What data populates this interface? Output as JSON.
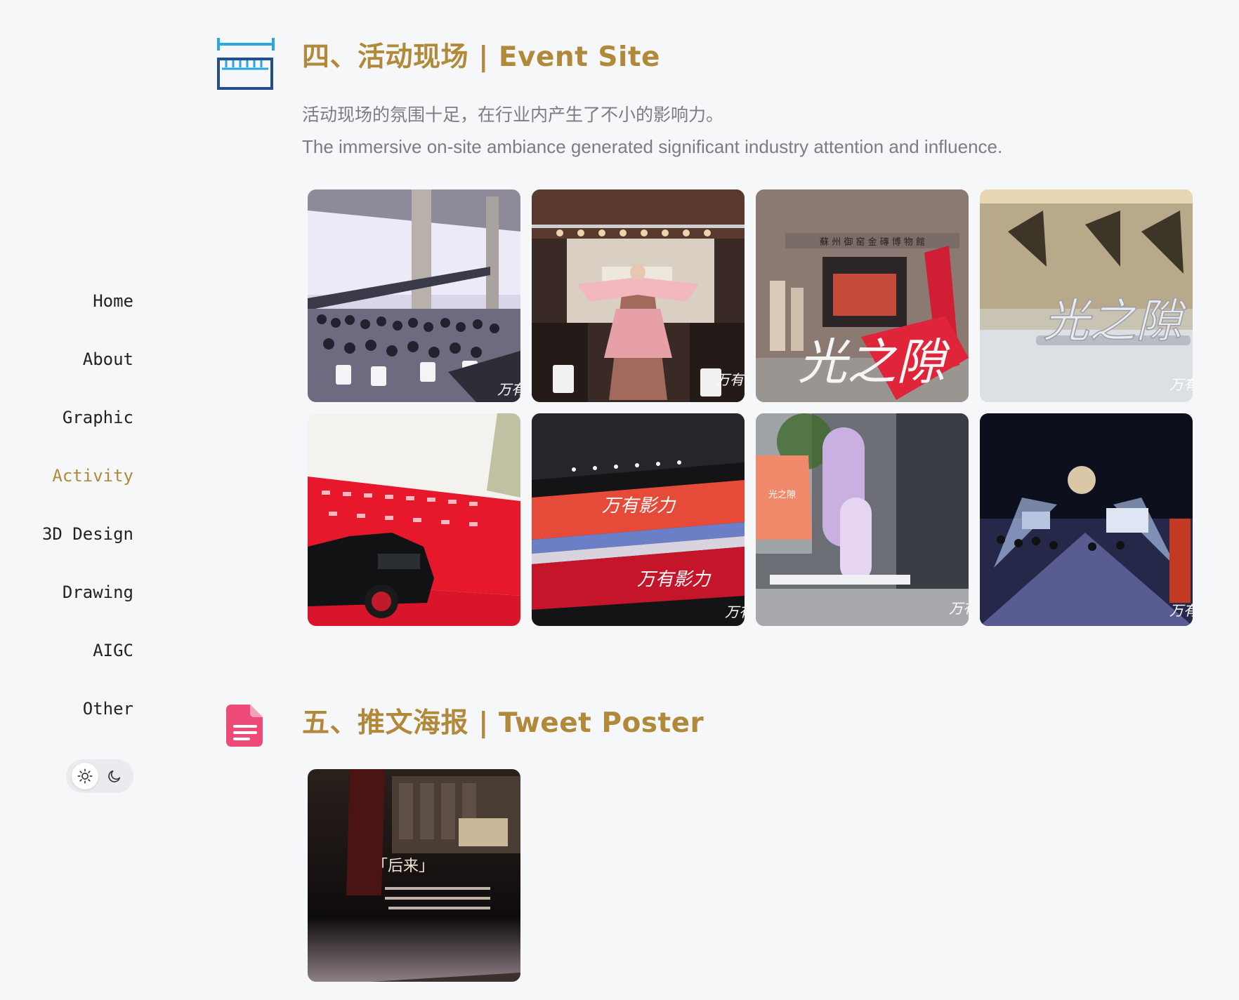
{
  "sidebar": {
    "nav": [
      {
        "label": "Home"
      },
      {
        "label": "About"
      },
      {
        "label": "Graphic"
      },
      {
        "label": "Activity"
      },
      {
        "label": "3D Design"
      },
      {
        "label": "Drawing"
      },
      {
        "label": "AIGC"
      },
      {
        "label": "Other"
      }
    ],
    "active_item": "Activity",
    "theme_toggle": {
      "options": [
        "sun-icon",
        "moon-icon"
      ],
      "selected": "light"
    }
  },
  "sections": {
    "event_site": {
      "title": "四、活动现场 | Event Site",
      "icon": "ruler-icon",
      "desc_cn": "活动现场的氛围十足，在行业内产生了不小的影响力。",
      "desc_en": "The immersive on-site ambiance generated significant industry attention and influence.",
      "photos": [
        {
          "subject": "runway-audience-photo",
          "overlay_text": "万有"
        },
        {
          "subject": "fashion-model-photo",
          "overlay_text": "万有"
        },
        {
          "subject": "museum-entrance-photo",
          "sign_text": "蘇 州 御 窑 金 磚 博 物 館",
          "overlay_text": "光之隙"
        },
        {
          "subject": "logo-sculpture-photo",
          "overlay_text": "光之隙"
        },
        {
          "subject": "red-carpet-car-photo",
          "overlay_text": ""
        },
        {
          "subject": "led-screen-photo",
          "overlay_text": "万有影力"
        },
        {
          "subject": "signage-installation-photo",
          "overlay_text": "光之隙"
        },
        {
          "subject": "night-stage-photo",
          "overlay_text": "万有"
        }
      ]
    },
    "tweet_poster": {
      "title": "五、推文海报 | Tweet Poster",
      "icon": "document-icon",
      "posters": [
        {
          "subject": "poster-thumbnail",
          "heading": "「后来」"
        }
      ]
    }
  },
  "colors": {
    "accent": "#b08a3a",
    "background": "#f6f7f9",
    "text": "#222222",
    "muted": "#7a7d84",
    "doc_icon": "#ee4a78",
    "ruler_light": "#2aa6e0",
    "ruler_dark": "#234e8c"
  }
}
